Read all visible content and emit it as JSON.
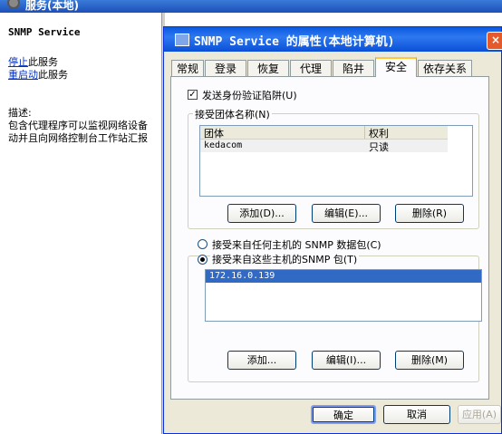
{
  "background_window": {
    "title": "服务(本地)",
    "service_name": "SNMP Service",
    "stop_link": "停止",
    "stop_suffix": "此服务",
    "restart_link": "重启动",
    "restart_suffix": "此服务",
    "description_label": "描述:",
    "description_line1": "包含代理程序可以监视网络设备",
    "description_line2": "动并且向网络控制台工作站汇报"
  },
  "dialog": {
    "title": "SNMP Service 的属性(本地计算机)",
    "close_label": "×",
    "tabs": [
      "常规",
      "登录",
      "恢复",
      "代理",
      "陷井",
      "安全",
      "依存关系"
    ],
    "active_tab": "安全",
    "send_auth_trap_label": "发送身份验证陷阱(U)",
    "send_auth_trap_checked": "✓",
    "community_group_label": "接受团体名称(N)",
    "community_columns": [
      "团体",
      "权利"
    ],
    "communities": [
      {
        "name": "kedacom",
        "right": "只读"
      }
    ],
    "community_buttons": {
      "add": "添加(D)...",
      "edit": "编辑(E)...",
      "remove": "删除(R)"
    },
    "accept_any_host_label": "接受来自任何主机的 SNMP 数据包(C)",
    "accept_these_hosts_label": "接受来自这些主机的SNMP 包(T)",
    "hosts": [
      "172.16.0.139"
    ],
    "host_buttons": {
      "add": "添加...",
      "edit": "编辑(I)...",
      "remove": "删除(M)"
    },
    "footer_buttons": {
      "ok": "确定",
      "cancel": "取消",
      "apply": "应用(A)"
    }
  }
}
